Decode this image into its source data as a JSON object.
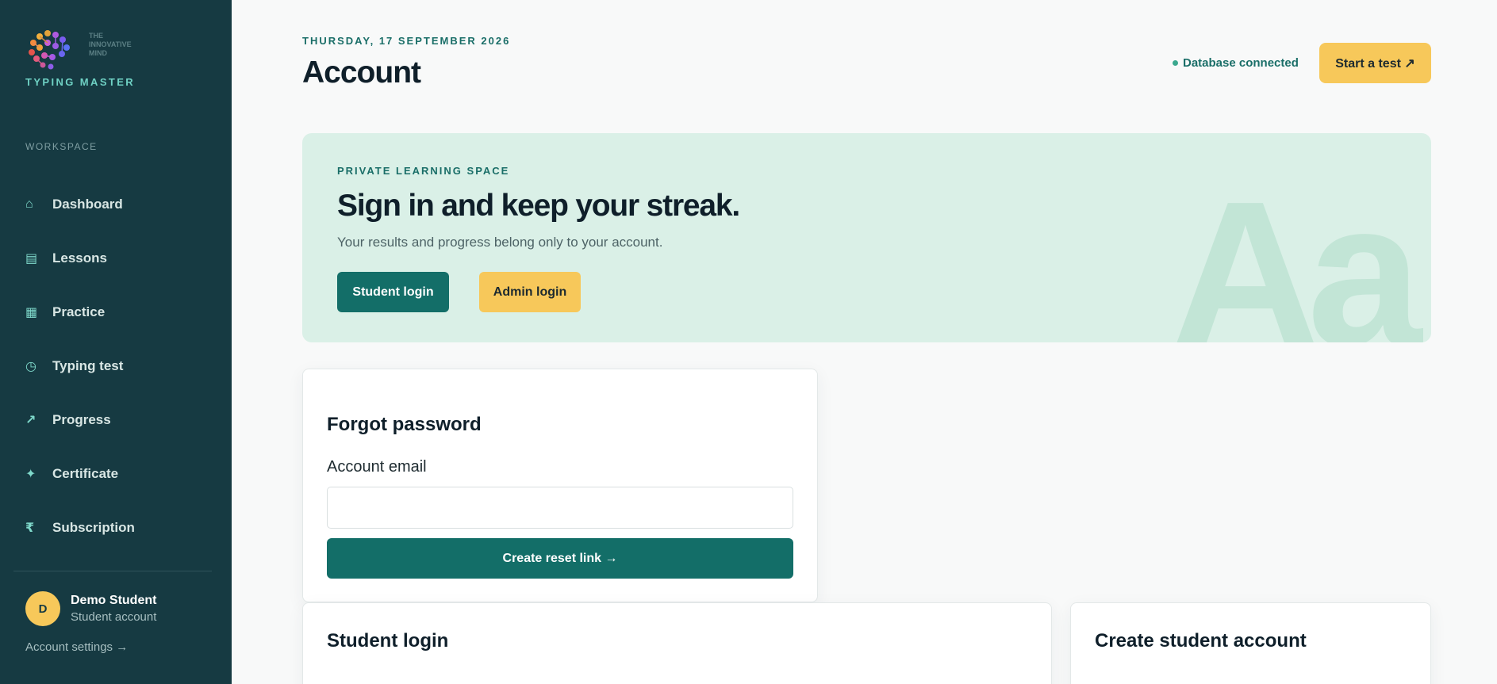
{
  "brand": {
    "small_text": "THE INNOVATIVE MIND",
    "name": "TYPING MASTER"
  },
  "sidebar": {
    "section_label": "WORKSPACE",
    "items": [
      {
        "label": "Dashboard",
        "icon": "home-icon"
      },
      {
        "label": "Lessons",
        "icon": "list-icon"
      },
      {
        "label": "Practice",
        "icon": "keyboard-icon"
      },
      {
        "label": "Typing test",
        "icon": "timer-icon"
      },
      {
        "label": "Progress",
        "icon": "arrow-up-right-icon"
      },
      {
        "label": "Certificate",
        "icon": "sparkle-icon"
      },
      {
        "label": "Subscription",
        "icon": "rupee-icon"
      }
    ],
    "user": {
      "initial": "D",
      "name": "Demo Student",
      "role": "Student account"
    },
    "account_settings": "Account settings →"
  },
  "header": {
    "date": "THURSDAY, 17 SEPTEMBER 2026",
    "title": "Account",
    "db_status": "Database connected",
    "start_button": "Start a test ↗"
  },
  "hero": {
    "kicker": "PRIVATE LEARNING SPACE",
    "title": "Sign in and keep your streak.",
    "subtitle": "Your results and progress belong only to your account.",
    "student_login": "Student login",
    "admin_login": "Admin login",
    "art_text": "Aa"
  },
  "forgot": {
    "title": "Forgot password",
    "email_label": "Account email",
    "email_value": "",
    "reset_button": "Create reset link →"
  },
  "cards": {
    "student_login_title": "Student login",
    "create_account_title": "Create student account"
  },
  "colors": {
    "sidebar_bg": "#163a42",
    "accent_teal": "#136e68",
    "accent_yellow": "#f7c85a",
    "hero_bg": "#daf0e7"
  }
}
